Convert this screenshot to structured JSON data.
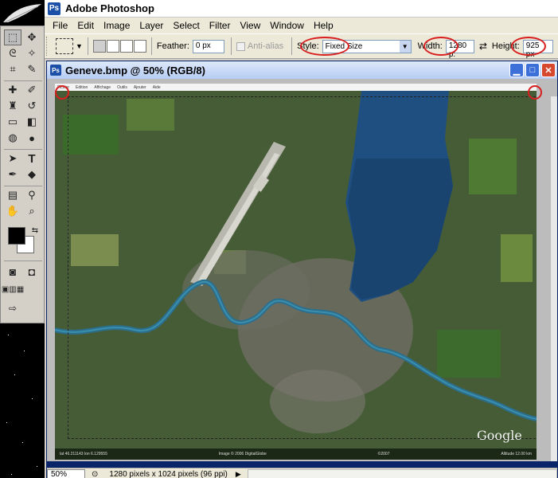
{
  "app": {
    "title": "Adobe Photoshop",
    "logo_text": "Ps"
  },
  "menu": [
    "File",
    "Edit",
    "Image",
    "Layer",
    "Select",
    "Filter",
    "View",
    "Window",
    "Help"
  ],
  "options": {
    "feather_label": "Feather:",
    "feather_value": "0 px",
    "antialias_label": "Anti-alias",
    "style_label": "Style:",
    "style_value": "Fixed Size",
    "width_label": "Width:",
    "width_value": "1280 p:",
    "height_label": "Height:",
    "height_value": "925 px"
  },
  "document": {
    "title": "Geneve.bmp @ 50% (RGB/8)",
    "map_menu": [
      "Fichier",
      "Edition",
      "Affichage",
      "Outils",
      "Ajouter",
      "Aide"
    ],
    "map_credit": "Image © 2006 DigitalGlobe",
    "map_copyright": "©2007",
    "map_altitude": "Altitude 12.00 km",
    "map_coords": "lat 46.211143  lon 6.129555",
    "google_logo": "Google"
  },
  "status": {
    "zoom": "50%",
    "doc_info": "1280 pixels x 1024 pixels (96 ppi)"
  },
  "colors": {
    "highlight": "#d81e1e",
    "title_gradient": "#b7cdf4",
    "lake": "#1f4f80"
  },
  "icons": [
    "marquee-icon",
    "move-icon",
    "lasso-icon",
    "magic-wand-icon",
    "crop-icon",
    "slice-icon",
    "healing-brush-icon",
    "brush-icon",
    "clone-stamp-icon",
    "history-brush-icon",
    "eraser-icon",
    "paint-bucket-icon",
    "blur-icon",
    "dodge-icon",
    "path-selection-icon",
    "type-icon",
    "pen-icon",
    "shape-icon",
    "notes-icon",
    "eyedropper-icon",
    "hand-icon",
    "zoom-icon"
  ]
}
